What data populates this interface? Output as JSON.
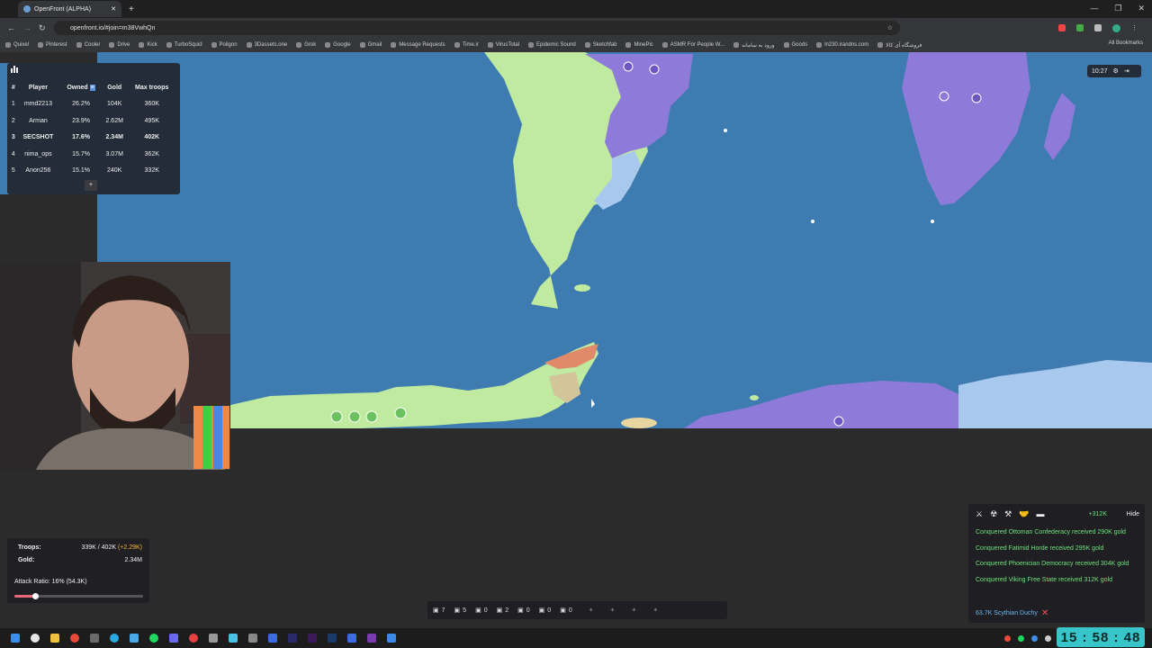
{
  "browser": {
    "tab_title": "OpenFront (ALPHA)",
    "url": "openfront.io/#join=m38VwhQn",
    "bookmarks": [
      "Quixel",
      "Pinterest",
      "Cooler",
      "Drive",
      "Kick",
      "TurboSquid",
      "Poligon",
      "3Dassets.one",
      "Grok",
      "Google",
      "Gmail",
      "Message Requests",
      "Time.ir",
      "VirusTotal",
      "Epidemic Sound",
      "Sketchfab",
      "MinePic",
      "ASMR For People W...",
      "ورود به سامانه",
      "Goods",
      "ln230.irandns.com",
      "فروشگاه آی کالا"
    ],
    "all_bookmarks": "All Bookmarks"
  },
  "leaderboard": {
    "headers": [
      "#",
      "Player",
      "Owned",
      "Gold",
      "Max troops"
    ],
    "rows": [
      {
        "rank": "1",
        "player": "mmd2213",
        "owned": "26.2%",
        "gold": "104K",
        "troops": "360K"
      },
      {
        "rank": "2",
        "player": "Arman",
        "owned": "23.9%",
        "gold": "2.62M",
        "troops": "495K"
      },
      {
        "rank": "3",
        "player": "SECSHOT",
        "owned": "17.6%",
        "gold": "2.34M",
        "troops": "402K"
      },
      {
        "rank": "4",
        "player": "nima_ops",
        "owned": "15.7%",
        "gold": "3.07M",
        "troops": "362K"
      },
      {
        "rank": "5",
        "player": "Anon256",
        "owned": "15.1%",
        "gold": "240K",
        "troops": "332K"
      }
    ],
    "expand": "+"
  },
  "timer": "10:27",
  "stats": {
    "troops_label": "Troops:",
    "troops_value": "339K / 402K",
    "troops_delta": "(+2.29K)",
    "gold_label": "Gold:",
    "gold_value": "2.34M",
    "attack_label": "Attack Ratio: 16% (54.3K)",
    "attack_ratio": 0.16
  },
  "events": {
    "income": "+312K",
    "hide": "Hide",
    "messages": [
      "Conquered Ottoman Confederacy received 290K gold",
      "Conquered Fatimid Horde received 295K gold",
      "Conquered Phoenician Democracy received 304K gold",
      "Conquered Viking Free State received 312K gold"
    ],
    "incoming": "63.7K Scythian Duchy"
  },
  "build_counts": [
    "7",
    "5",
    "0",
    "2",
    "0",
    "0",
    "0"
  ],
  "clock": "15 : 58 : 48",
  "colors": {
    "ocean": "#3d7bb0",
    "green": "#bfeaa0",
    "purple": "#8e7ad8",
    "light_blue": "#a9c8ee",
    "event_green": "#6fe07a",
    "event_blue": "#6ab8f0",
    "clock": "#37c5c9"
  }
}
